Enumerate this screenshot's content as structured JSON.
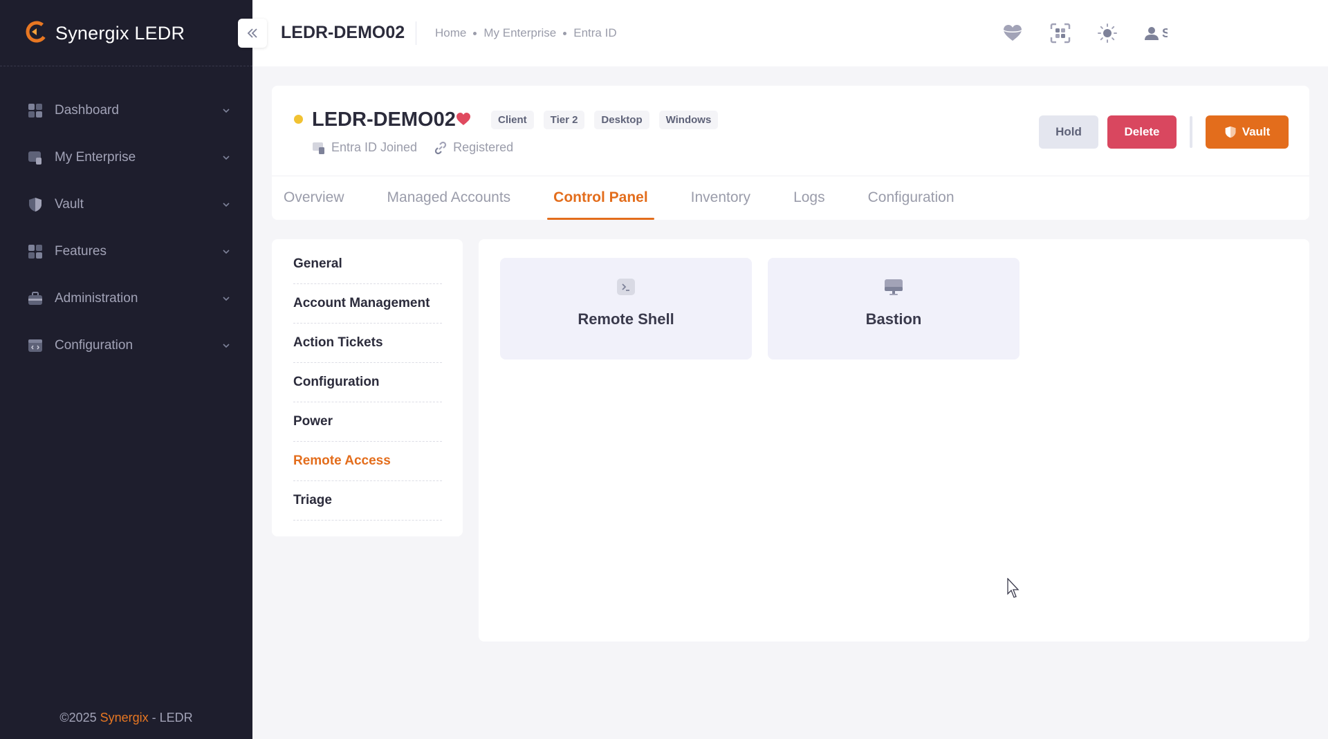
{
  "sidebar": {
    "brand": "Synergix LEDR",
    "items": [
      {
        "label": "Dashboard",
        "icon": "dashboard-icon"
      },
      {
        "label": "My Enterprise",
        "icon": "enterprise-icon"
      },
      {
        "label": "Vault",
        "icon": "vault-shield-icon"
      },
      {
        "label": "Features",
        "icon": "features-grid-icon"
      },
      {
        "label": "Administration",
        "icon": "briefcase-icon"
      },
      {
        "label": "Configuration",
        "icon": "code-window-icon"
      }
    ],
    "footer": {
      "prefix": "©2025 ",
      "brand": "Synergix",
      "suffix": " - LEDR"
    }
  },
  "header": {
    "title": "LEDR-DEMO02",
    "breadcrumb": [
      "Home",
      "My Enterprise",
      "Entra ID"
    ],
    "icons": [
      "heart-icon",
      "scan-icon",
      "sun-icon",
      "user-icon"
    ],
    "user_initial": "S"
  },
  "device": {
    "name": "LEDR-DEMO02",
    "status_color": "#f1c232",
    "tags": [
      "Client",
      "Tier 2",
      "Desktop",
      "Windows"
    ],
    "meta": {
      "join_status": "Entra ID Joined",
      "registration": "Registered"
    },
    "actions": {
      "hold": "Hold",
      "delete": "Delete",
      "vault": "Vault"
    },
    "tabs": [
      "Overview",
      "Managed Accounts",
      "Control Panel",
      "Inventory",
      "Logs",
      "Configuration"
    ],
    "active_tab": "Control Panel"
  },
  "control_panel": {
    "menu": [
      "General",
      "Account Management",
      "Action Tickets",
      "Configuration",
      "Power",
      "Remote Access",
      "Triage"
    ],
    "active_menu": "Remote Access",
    "tiles": [
      {
        "label": "Remote Shell",
        "icon": "terminal-icon"
      },
      {
        "label": "Bastion",
        "icon": "monitor-icon"
      }
    ]
  },
  "colors": {
    "accent": "#e36d1c",
    "sidebar_bg": "#1e1e2d",
    "danger": "#d9475f",
    "favorite": "#e04a5f"
  }
}
